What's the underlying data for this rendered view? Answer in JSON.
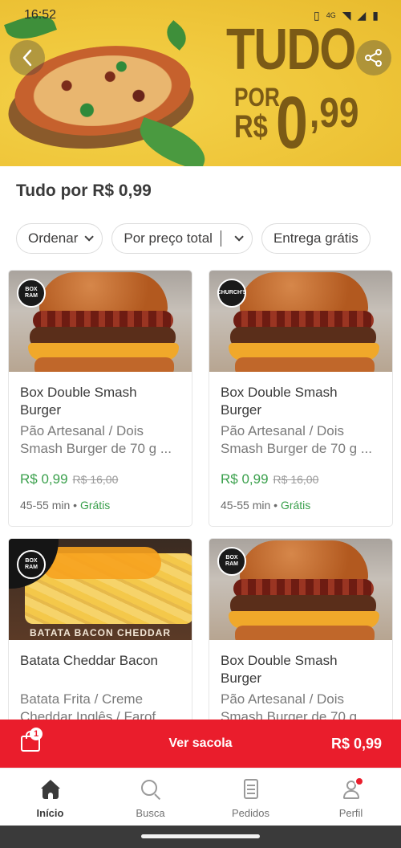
{
  "status_bar": {
    "time": "16:52",
    "network": "4G"
  },
  "banner": {
    "promo_line1": "TUDO",
    "promo_por": "POR",
    "promo_currency": "R$",
    "promo_integer": "0",
    "promo_cents": ",99"
  },
  "page": {
    "title": "Tudo por R$ 0,99"
  },
  "filters": [
    {
      "label": "Ordenar"
    },
    {
      "label": "Por preço total"
    },
    {
      "label": "Entrega grátis"
    }
  ],
  "products": [
    {
      "name": "Box Double Smash Burger",
      "description": "Pão Artesanal / Dois Smash Burger de 70 g ...",
      "price": "R$ 0,99",
      "old_price": "R$ 16,00",
      "eta": "45-55 min",
      "delivery": "Grátis",
      "logo_text": "BOX RAM"
    },
    {
      "name": "Box Double Smash Burger",
      "description": "Pão Artesanal / Dois Smash Burger de 70 g ...",
      "price": "R$ 0,99",
      "old_price": "R$ 16,00",
      "eta": "45-55 min",
      "delivery": "Grátis",
      "logo_text": "CHURCH'S"
    },
    {
      "name": "Batata Cheddar Bacon",
      "description": "Batata Frita / Creme Cheddar Inglês / Farof",
      "image_caption": "BATATA BACON CHEDDAR",
      "logo_text": "BOX RAM"
    },
    {
      "name": "Box Double Smash Burger",
      "description": "Pão Artesanal / Dois Smash Burger de 70 g",
      "logo_text": "BOX RAM"
    }
  ],
  "bag": {
    "count": "1",
    "label": "Ver sacola",
    "total": "R$ 0,99"
  },
  "bottom_nav": [
    {
      "label": "Início",
      "icon": "home-icon",
      "active": true
    },
    {
      "label": "Busca",
      "icon": "search-icon"
    },
    {
      "label": "Pedidos",
      "icon": "orders-icon"
    },
    {
      "label": "Perfil",
      "icon": "profile-icon"
    }
  ],
  "colors": {
    "accent_red": "#ea1d2c",
    "price_green": "#3aa04c",
    "banner_yellow": "#efc63a"
  }
}
